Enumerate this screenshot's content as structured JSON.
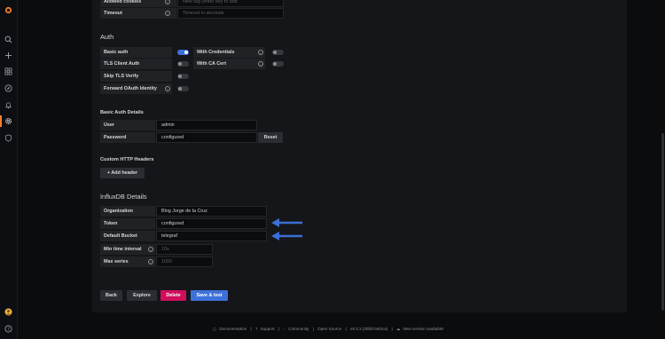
{
  "top_rows": {
    "allowed_cookies": {
      "label": "Allowed cookies",
      "placeholder": "New tag (enter key to add"
    },
    "timeout": {
      "label": "Timeout",
      "placeholder": "Timeout in seconds"
    }
  },
  "auth": {
    "title": "Auth",
    "basic_auth": "Basic auth",
    "with_credentials": "With Credentials",
    "tls_client_auth": "TLS Client Auth",
    "with_ca_cert": "With CA Cert",
    "skip_tls_verify": "Skip TLS Verify",
    "forward_oauth": "Forward OAuth Identity",
    "states": {
      "basic_auth": true,
      "with_credentials": false,
      "tls_client_auth": false,
      "with_ca_cert": false,
      "skip_tls_verify": false,
      "forward_oauth": false
    }
  },
  "basic_auth_details": {
    "title": "Basic Auth Details",
    "user_label": "User",
    "user_value": "admin",
    "password_label": "Password",
    "password_value": "configured",
    "reset": "Reset"
  },
  "custom_headers": {
    "title": "Custom HTTP Headers",
    "add": "Add header"
  },
  "influx": {
    "title": "InfluxDB Details",
    "organization_label": "Organization",
    "organization_value": "Blog Jorge de la Cruz",
    "token_label": "Token",
    "token_value": "configured",
    "bucket_label": "Default Bucket",
    "bucket_value": "telegraf",
    "min_interval_label": "Min time interval",
    "min_interval_placeholder": "10s",
    "max_series_label": "Max series",
    "max_series_placeholder": "1000"
  },
  "buttons": {
    "back": "Back",
    "explore": "Explore",
    "delete": "Delete",
    "save": "Save & test"
  },
  "footer": [
    "Documentation",
    "|",
    "Support",
    "|",
    "Community",
    "|",
    "Open Source",
    "|",
    "v8.3.3 (30bb7a93ca)",
    "|",
    "New version available!"
  ],
  "colors": {
    "accent": "#3d71d9",
    "danger": "#d10e5c",
    "arrow": "#3b6fd6",
    "logo": "#f77f28"
  }
}
